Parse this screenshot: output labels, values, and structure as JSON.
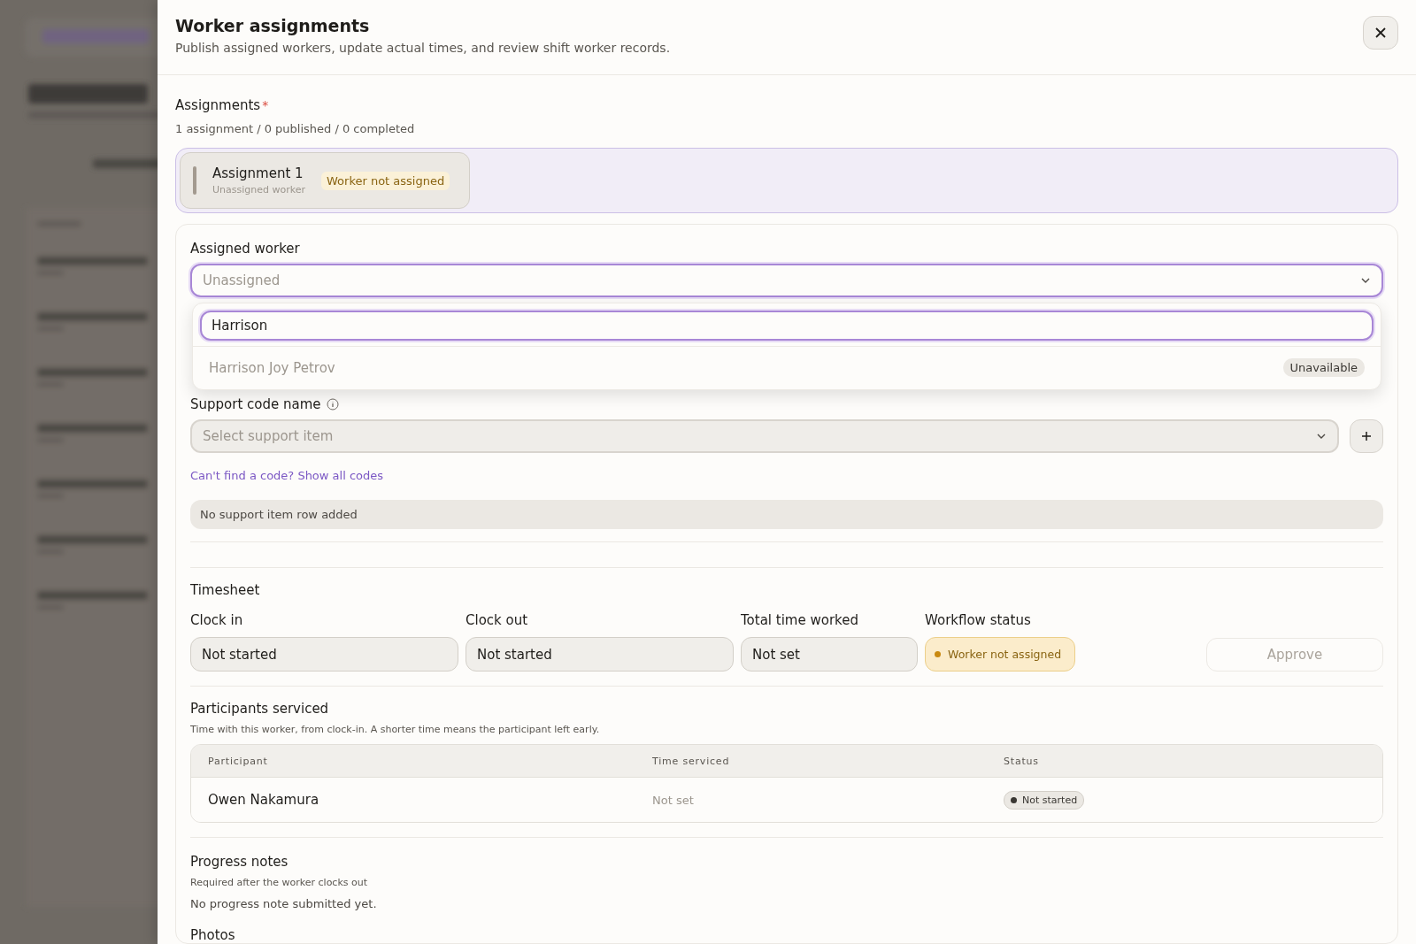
{
  "drawer": {
    "title": "Worker assignments",
    "subtitle": "Publish assigned workers, update actual times, and review shift worker records."
  },
  "assignments": {
    "label": "Assignments",
    "required_mark": "*",
    "summary": "1 assignment / 0 published / 0 completed",
    "items": [
      {
        "title": "Assignment 1",
        "worker": "Unassigned worker",
        "badge": "Worker not assigned",
        "selected": true
      }
    ]
  },
  "assigned_worker": {
    "label": "Assigned worker",
    "placeholder": "Unassigned",
    "expanded": true,
    "search_value": "Harrison",
    "options": [
      {
        "name": "Harrison Joy Petrov",
        "badge": "Unavailable",
        "disabled": true
      }
    ]
  },
  "support_code": {
    "label": "Support code name",
    "placeholder": "Select support item",
    "link": "Can't find a code? Show all codes",
    "empty_row": "No support item row added"
  },
  "timesheet": {
    "title": "Timesheet",
    "fields": [
      {
        "label": "Clock in",
        "value": "Not started",
        "kind": "field"
      },
      {
        "label": "Clock out",
        "value": "Not started",
        "kind": "field"
      },
      {
        "label": "Total time worked",
        "value": "Not set",
        "kind": "field"
      },
      {
        "label": "Workflow status",
        "value": "Worker not assigned",
        "kind": "status"
      }
    ],
    "approve": {
      "label": "Approve",
      "disabled": true
    }
  },
  "participants": {
    "title": "Participants serviced",
    "caption": "Time with this worker, from clock-in. A shorter time means the participant left early.",
    "columns": [
      "Participant",
      "Time serviced",
      "Status"
    ],
    "rows": [
      {
        "participant": "Owen Nakamura",
        "time": "Not set",
        "status": "Not started"
      }
    ]
  },
  "progress_notes": {
    "title": "Progress notes",
    "caption": "Required after the worker clocks out",
    "empty": "No progress note submitted yet."
  },
  "photos": {
    "title": "Photos"
  }
}
